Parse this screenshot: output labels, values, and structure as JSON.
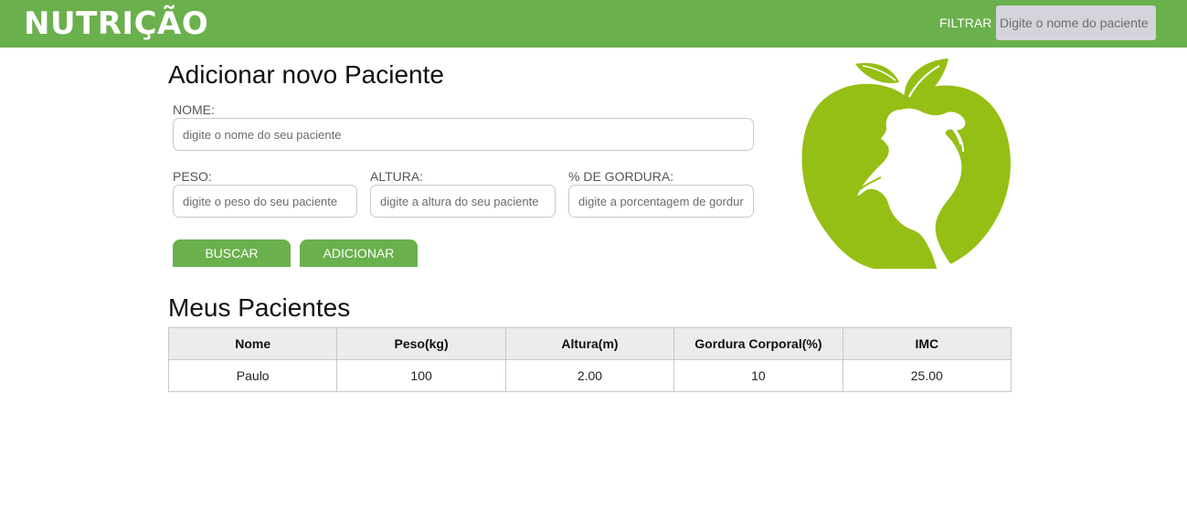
{
  "header": {
    "logo": "NUTRIÇÃO",
    "filter_label": "FILTRAR",
    "filter_placeholder": "Digite o nome do paciente",
    "color": "#6ab04c"
  },
  "form": {
    "title": "Adicionar novo Paciente",
    "nome": {
      "label": "NOME:",
      "placeholder": "digite o nome do seu paciente",
      "value": ""
    },
    "peso": {
      "label": "PESO:",
      "placeholder": "digite o peso do seu paciente",
      "value": ""
    },
    "altura": {
      "label": "ALTURA:",
      "placeholder": "digite a altura do seu paciente",
      "value": ""
    },
    "gordura": {
      "label": "% DE GORDURA:",
      "placeholder": "digite a porcentagem de gordura",
      "value": ""
    },
    "buscar_label": "BUSCAR",
    "adicionar_label": "ADICIONAR"
  },
  "logo_image": {
    "icon": "apple-woman-silhouette-icon",
    "color": "#95bf14"
  },
  "patients": {
    "title": "Meus Pacientes",
    "columns": [
      "Nome",
      "Peso(kg)",
      "Altura(m)",
      "Gordura Corporal(%)",
      "IMC"
    ],
    "rows": [
      [
        "Paulo",
        "100",
        "2.00",
        "10",
        "25.00"
      ]
    ]
  }
}
